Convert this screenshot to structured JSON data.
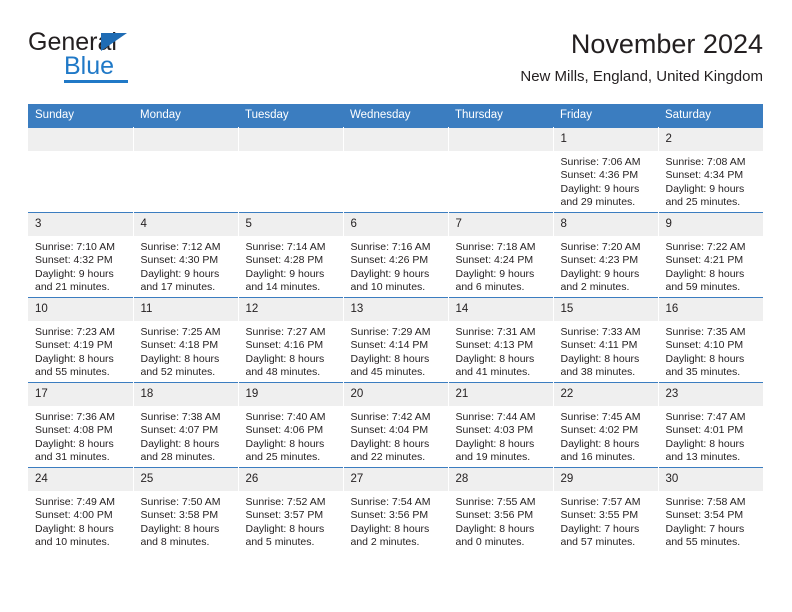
{
  "brand": {
    "name_top": "General",
    "name_bottom": "Blue",
    "accent_color": "#2079c7",
    "triangle_color": "#1f6cb4"
  },
  "header": {
    "title": "November 2024",
    "subtitle": "New Mills, England, United Kingdom"
  },
  "calendar": {
    "header_bg": "#3b7dc0",
    "daynum_bg": "#efefef",
    "weekday_headers": [
      "Sunday",
      "Monday",
      "Tuesday",
      "Wednesday",
      "Thursday",
      "Friday",
      "Saturday"
    ],
    "weeks": [
      [
        {
          "day": "",
          "lines": []
        },
        {
          "day": "",
          "lines": []
        },
        {
          "day": "",
          "lines": []
        },
        {
          "day": "",
          "lines": []
        },
        {
          "day": "",
          "lines": []
        },
        {
          "day": "1",
          "lines": [
            "Sunrise: 7:06 AM",
            "Sunset: 4:36 PM",
            "Daylight: 9 hours",
            "and 29 minutes."
          ]
        },
        {
          "day": "2",
          "lines": [
            "Sunrise: 7:08 AM",
            "Sunset: 4:34 PM",
            "Daylight: 9 hours",
            "and 25 minutes."
          ]
        }
      ],
      [
        {
          "day": "3",
          "lines": [
            "Sunrise: 7:10 AM",
            "Sunset: 4:32 PM",
            "Daylight: 9 hours",
            "and 21 minutes."
          ]
        },
        {
          "day": "4",
          "lines": [
            "Sunrise: 7:12 AM",
            "Sunset: 4:30 PM",
            "Daylight: 9 hours",
            "and 17 minutes."
          ]
        },
        {
          "day": "5",
          "lines": [
            "Sunrise: 7:14 AM",
            "Sunset: 4:28 PM",
            "Daylight: 9 hours",
            "and 14 minutes."
          ]
        },
        {
          "day": "6",
          "lines": [
            "Sunrise: 7:16 AM",
            "Sunset: 4:26 PM",
            "Daylight: 9 hours",
            "and 10 minutes."
          ]
        },
        {
          "day": "7",
          "lines": [
            "Sunrise: 7:18 AM",
            "Sunset: 4:24 PM",
            "Daylight: 9 hours",
            "and 6 minutes."
          ]
        },
        {
          "day": "8",
          "lines": [
            "Sunrise: 7:20 AM",
            "Sunset: 4:23 PM",
            "Daylight: 9 hours",
            "and 2 minutes."
          ]
        },
        {
          "day": "9",
          "lines": [
            "Sunrise: 7:22 AM",
            "Sunset: 4:21 PM",
            "Daylight: 8 hours",
            "and 59 minutes."
          ]
        }
      ],
      [
        {
          "day": "10",
          "lines": [
            "Sunrise: 7:23 AM",
            "Sunset: 4:19 PM",
            "Daylight: 8 hours",
            "and 55 minutes."
          ]
        },
        {
          "day": "11",
          "lines": [
            "Sunrise: 7:25 AM",
            "Sunset: 4:18 PM",
            "Daylight: 8 hours",
            "and 52 minutes."
          ]
        },
        {
          "day": "12",
          "lines": [
            "Sunrise: 7:27 AM",
            "Sunset: 4:16 PM",
            "Daylight: 8 hours",
            "and 48 minutes."
          ]
        },
        {
          "day": "13",
          "lines": [
            "Sunrise: 7:29 AM",
            "Sunset: 4:14 PM",
            "Daylight: 8 hours",
            "and 45 minutes."
          ]
        },
        {
          "day": "14",
          "lines": [
            "Sunrise: 7:31 AM",
            "Sunset: 4:13 PM",
            "Daylight: 8 hours",
            "and 41 minutes."
          ]
        },
        {
          "day": "15",
          "lines": [
            "Sunrise: 7:33 AM",
            "Sunset: 4:11 PM",
            "Daylight: 8 hours",
            "and 38 minutes."
          ]
        },
        {
          "day": "16",
          "lines": [
            "Sunrise: 7:35 AM",
            "Sunset: 4:10 PM",
            "Daylight: 8 hours",
            "and 35 minutes."
          ]
        }
      ],
      [
        {
          "day": "17",
          "lines": [
            "Sunrise: 7:36 AM",
            "Sunset: 4:08 PM",
            "Daylight: 8 hours",
            "and 31 minutes."
          ]
        },
        {
          "day": "18",
          "lines": [
            "Sunrise: 7:38 AM",
            "Sunset: 4:07 PM",
            "Daylight: 8 hours",
            "and 28 minutes."
          ]
        },
        {
          "day": "19",
          "lines": [
            "Sunrise: 7:40 AM",
            "Sunset: 4:06 PM",
            "Daylight: 8 hours",
            "and 25 minutes."
          ]
        },
        {
          "day": "20",
          "lines": [
            "Sunrise: 7:42 AM",
            "Sunset: 4:04 PM",
            "Daylight: 8 hours",
            "and 22 minutes."
          ]
        },
        {
          "day": "21",
          "lines": [
            "Sunrise: 7:44 AM",
            "Sunset: 4:03 PM",
            "Daylight: 8 hours",
            "and 19 minutes."
          ]
        },
        {
          "day": "22",
          "lines": [
            "Sunrise: 7:45 AM",
            "Sunset: 4:02 PM",
            "Daylight: 8 hours",
            "and 16 minutes."
          ]
        },
        {
          "day": "23",
          "lines": [
            "Sunrise: 7:47 AM",
            "Sunset: 4:01 PM",
            "Daylight: 8 hours",
            "and 13 minutes."
          ]
        }
      ],
      [
        {
          "day": "24",
          "lines": [
            "Sunrise: 7:49 AM",
            "Sunset: 4:00 PM",
            "Daylight: 8 hours",
            "and 10 minutes."
          ]
        },
        {
          "day": "25",
          "lines": [
            "Sunrise: 7:50 AM",
            "Sunset: 3:58 PM",
            "Daylight: 8 hours",
            "and 8 minutes."
          ]
        },
        {
          "day": "26",
          "lines": [
            "Sunrise: 7:52 AM",
            "Sunset: 3:57 PM",
            "Daylight: 8 hours",
            "and 5 minutes."
          ]
        },
        {
          "day": "27",
          "lines": [
            "Sunrise: 7:54 AM",
            "Sunset: 3:56 PM",
            "Daylight: 8 hours",
            "and 2 minutes."
          ]
        },
        {
          "day": "28",
          "lines": [
            "Sunrise: 7:55 AM",
            "Sunset: 3:56 PM",
            "Daylight: 8 hours",
            "and 0 minutes."
          ]
        },
        {
          "day": "29",
          "lines": [
            "Sunrise: 7:57 AM",
            "Sunset: 3:55 PM",
            "Daylight: 7 hours",
            "and 57 minutes."
          ]
        },
        {
          "day": "30",
          "lines": [
            "Sunrise: 7:58 AM",
            "Sunset: 3:54 PM",
            "Daylight: 7 hours",
            "and 55 minutes."
          ]
        }
      ]
    ]
  }
}
